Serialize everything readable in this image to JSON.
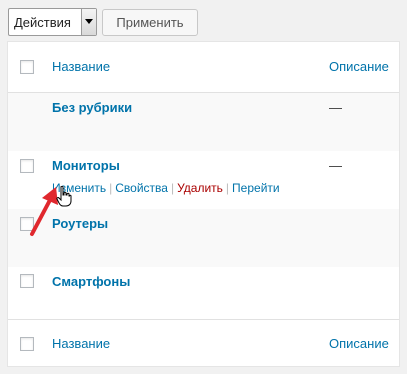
{
  "toolbar": {
    "bulk_action_selected": "Действия",
    "apply_label": "Применить"
  },
  "table": {
    "columns": {
      "name": "Название",
      "description": "Описание"
    },
    "rows": [
      {
        "name": "Без рубрики",
        "description": "—"
      },
      {
        "name": "Мониторы",
        "description": "—",
        "actions": {
          "edit": "Изменить",
          "properties": "Свойства",
          "delete": "Удалить",
          "view": "Перейти"
        }
      },
      {
        "name": "Роутеры",
        "description": ""
      },
      {
        "name": "Смартфоны",
        "description": ""
      }
    ],
    "action_separator": "|"
  },
  "colors": {
    "link": "#0073aa",
    "delete_link": "#aa0000",
    "annotation_arrow": "#e0282e"
  },
  "icons": [
    "chevron-down-icon",
    "hand-pointer-icon",
    "annotation-arrow-icon"
  ]
}
